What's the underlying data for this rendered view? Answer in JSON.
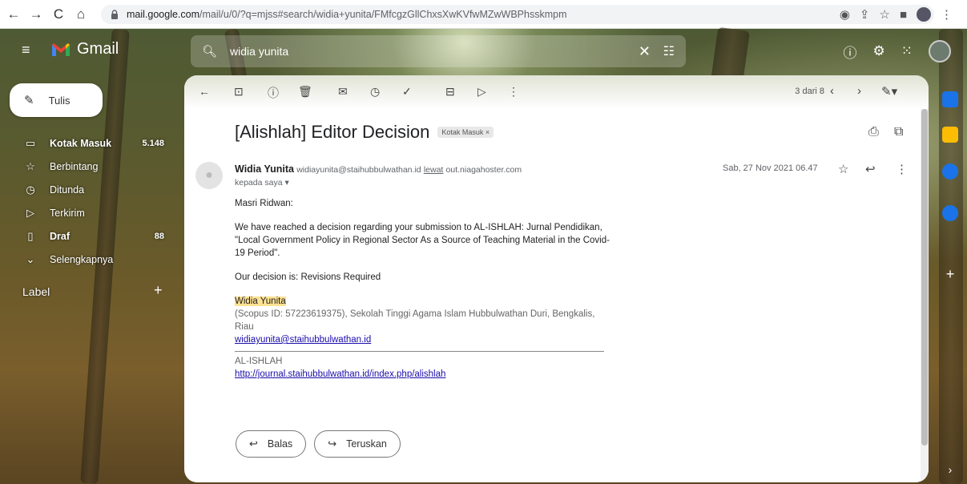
{
  "browser": {
    "url_domain": "mail.google.com",
    "url_path": "/mail/u/0/?q=mjss#search/widia+yunita/FMfcgzGllChxsXwKVfwMZwWBPhsskmpm"
  },
  "gmail": {
    "logo_text": "Gmail",
    "search_value": "widia yunita",
    "compose_label": "Tulis"
  },
  "sidebar": {
    "items": [
      {
        "label": "Kotak Masuk",
        "count": "5.148",
        "icon": "inbox-icon"
      },
      {
        "label": "Berbintang",
        "count": "",
        "icon": "star-icon"
      },
      {
        "label": "Ditunda",
        "count": "",
        "icon": "clock-icon"
      },
      {
        "label": "Terkirim",
        "count": "",
        "icon": "send-icon"
      },
      {
        "label": "Draf",
        "count": "88",
        "icon": "file-icon"
      },
      {
        "label": "Selengkapnya",
        "count": "",
        "icon": "chevron-down-icon"
      }
    ],
    "label_heading": "Label"
  },
  "toolbar": {
    "pager": "3 dari 8"
  },
  "email": {
    "subject": "[Alishlah] Editor Decision",
    "tag": "Kotak Masuk",
    "sender_name": "Widia Yunita",
    "sender_email": "widiayunita@staihubbulwathan.id",
    "via": "lewat",
    "via_domain": "out.niagahoster.com",
    "to_me": "kepada saya",
    "date": "Sab, 27 Nov 2021 06.47",
    "greeting": "Masri Ridwan:",
    "para1": "We have reached a decision regarding your submission to AL-ISHLAH: Jurnal Pendidikan, \"Local Government Policy in Regional Sector As a Source of Teaching Material in the Covid-19 Period\".",
    "para2": "Our decision is: Revisions Required",
    "sig_name": "Widia Yunita",
    "sig_line1": "(Scopus ID: 57223619375), Sekolah Tinggi Agama Islam Hubbulwathan Duri, Bengkalis, Riau",
    "sig_email": "widiayunita@staihubbulwathan.id",
    "journal_name": "AL-ISHLAH",
    "journal_url": "http://journal.staihubbulwathan.id/index.php/alishlah"
  },
  "buttons": {
    "reply": "Balas",
    "forward": "Teruskan"
  }
}
